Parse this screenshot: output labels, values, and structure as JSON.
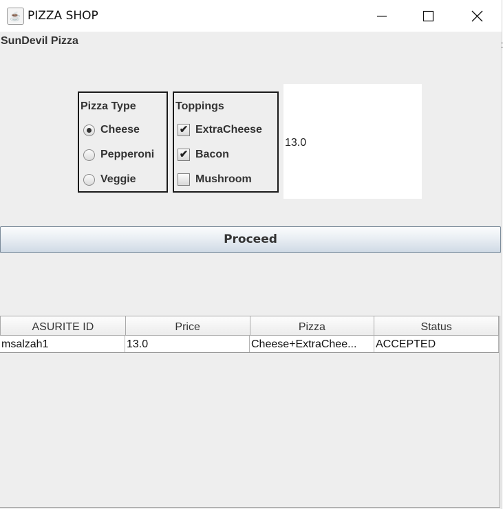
{
  "window": {
    "title": "PIZZA SHOP",
    "icon": "java-coffee-icon"
  },
  "app": {
    "label": "SunDevil Pizza"
  },
  "pizza_type": {
    "title": "Pizza Type",
    "options": [
      {
        "label": "Cheese",
        "selected": true
      },
      {
        "label": "Pepperoni",
        "selected": false
      },
      {
        "label": "Veggie",
        "selected": false
      }
    ]
  },
  "toppings": {
    "title": "Toppings",
    "options": [
      {
        "label": "ExtraCheese",
        "checked": true
      },
      {
        "label": "Bacon",
        "checked": true
      },
      {
        "label": "Mushroom",
        "checked": false
      }
    ]
  },
  "price_display": {
    "value": "13.0"
  },
  "proceed_label": "Proceed",
  "table": {
    "columns": [
      "ASURITE ID",
      "Price",
      "Pizza",
      "Status"
    ],
    "rows": [
      [
        "msalzah1",
        "13.0",
        "Cheese+ExtraChee...",
        "ACCEPTED"
      ]
    ]
  },
  "check_mark": "✔"
}
